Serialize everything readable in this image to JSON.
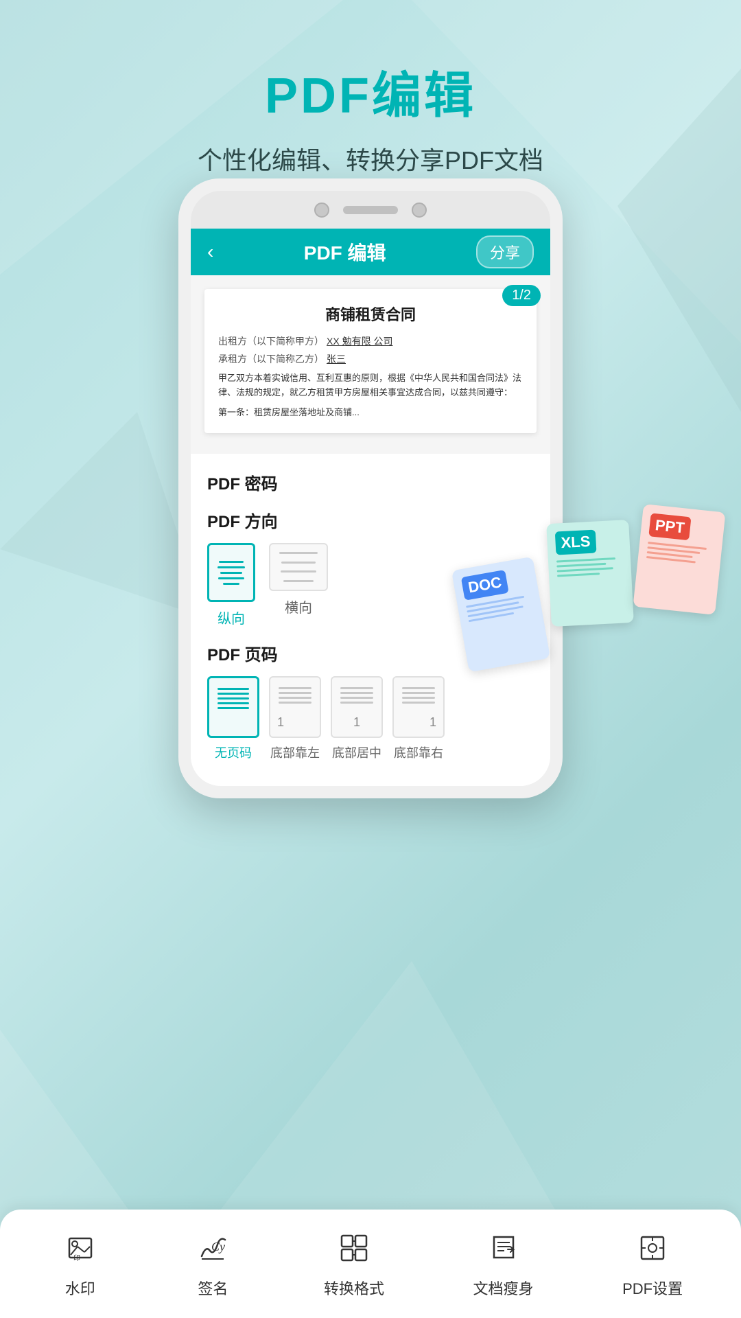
{
  "background": {
    "color_top": "#b2dfe0",
    "color_bottom": "#a0d0d0"
  },
  "header": {
    "main_title": "PDF编辑",
    "subtitle": "个性化编辑、转换分享PDF文档"
  },
  "app_bar": {
    "back_label": "‹",
    "title": "PDF 编辑",
    "share_label": "分享"
  },
  "document": {
    "page_badge": "1/2",
    "title": "商铺租赁合同",
    "line1_label": "出租方（以下简称甲方）",
    "line1_value": "XX 勉有限 公司",
    "line2_label": "承租方（以下简称乙方）",
    "line2_value": "张三",
    "paragraph": "甲乙双方本着实诚信用、互利互惠的原则，根据《中华人民共和国合同法》法律、法规的规定，就乙方租赁甲方房屋相关事宜达成合同，以兹共同遵守：",
    "paragraph2": "第一条：租赁房屋坐落地址及商铺..."
  },
  "pdf_password": {
    "label": "PDF 密码"
  },
  "pdf_orientation": {
    "label": "PDF 方向",
    "options": [
      {
        "id": "portrait",
        "label": "纵向",
        "active": true
      },
      {
        "id": "landscape",
        "label": "横向",
        "active": false
      }
    ]
  },
  "pdf_pagenum": {
    "label": "PDF 页码",
    "options": [
      {
        "id": "none",
        "label": "无页码",
        "active": true,
        "number": null,
        "align": null
      },
      {
        "id": "bottom-left",
        "label": "底部靠左",
        "active": false,
        "number": "1",
        "align": "left"
      },
      {
        "id": "bottom-center",
        "label": "底部居中",
        "active": false,
        "number": "1",
        "align": "center"
      },
      {
        "id": "bottom-right",
        "label": "底部靠右",
        "active": false,
        "number": "1",
        "align": "right"
      }
    ]
  },
  "toolbar": {
    "items": [
      {
        "id": "watermark",
        "label": "水印",
        "icon": "watermark-icon"
      },
      {
        "id": "signature",
        "label": "签名",
        "icon": "signature-icon"
      },
      {
        "id": "convert",
        "label": "转换格式",
        "icon": "convert-icon"
      },
      {
        "id": "compress",
        "label": "文档瘦身",
        "icon": "compress-icon"
      },
      {
        "id": "settings",
        "label": "PDF设置",
        "icon": "settings-icon"
      }
    ]
  },
  "file_formats": [
    {
      "id": "doc",
      "label": "DOC",
      "badge_color": "#4285f4"
    },
    {
      "id": "xls",
      "label": "XLS",
      "badge_color": "#00b4b4"
    },
    {
      "id": "ppt",
      "label": "PPT",
      "badge_color": "#e84c3d"
    }
  ]
}
